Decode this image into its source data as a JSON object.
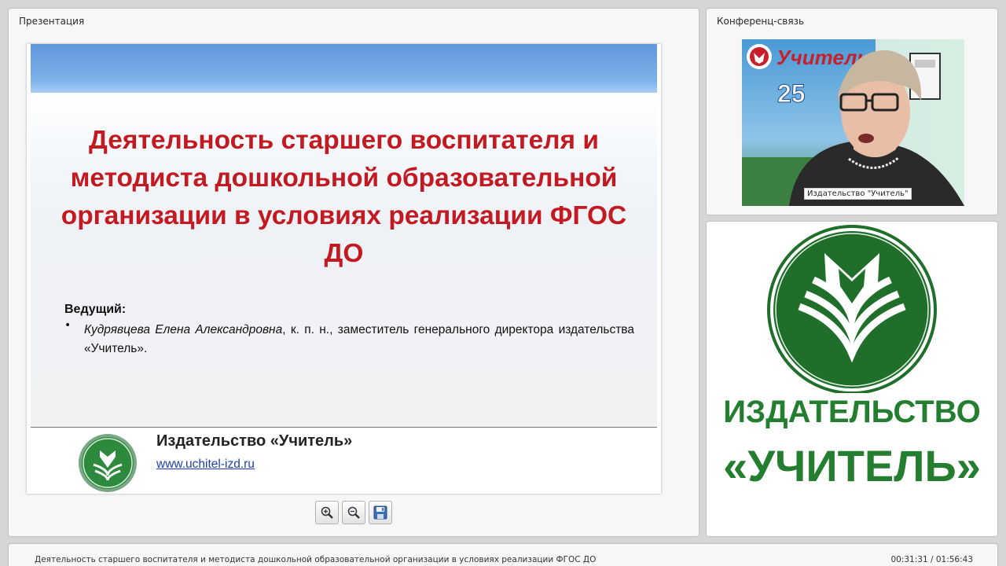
{
  "presentation_panel": {
    "title": "Презентация",
    "slide": {
      "title": "Деятельность старшего воспитателя и методиста дошкольной образовательной организации в условиях реализации ФГОС ДО",
      "host_label": "Ведущий:",
      "host_bullet": "•",
      "host_name": "Кудрявцева Елена Александровна",
      "host_details": ", к. п. н., заместитель генерального директора издательства «Учитель».",
      "publisher_name": "Издательство «Учитель»",
      "publisher_url": "www.uchitel-izd.ru"
    },
    "toolbar": {
      "zoom_in_icon": "zoom-in-icon",
      "zoom_out_icon": "zoom-out-icon",
      "save_icon": "floppy-disk-icon"
    }
  },
  "conference_panel": {
    "title": "Конференц-связь",
    "video_label": "Издательство \"Учитель\"",
    "poster_word": "Учитель",
    "poster_number": "25"
  },
  "brand_panel": {
    "line1": "ИЗДАТЕЛЬСТВО",
    "line2": "«УЧИТЕЛЬ»"
  },
  "status_bar": {
    "title": "Деятельность старшего воспитателя и методиста дошкольной образовательной организации в условиях реализации ФГОС ДО",
    "time": "00:31:31 / 01:56:43"
  },
  "colors": {
    "title_red": "#c31a22",
    "brand_green": "#247e2f",
    "header_blue": "#6fa4e4",
    "link_blue": "#1f3fb4"
  }
}
